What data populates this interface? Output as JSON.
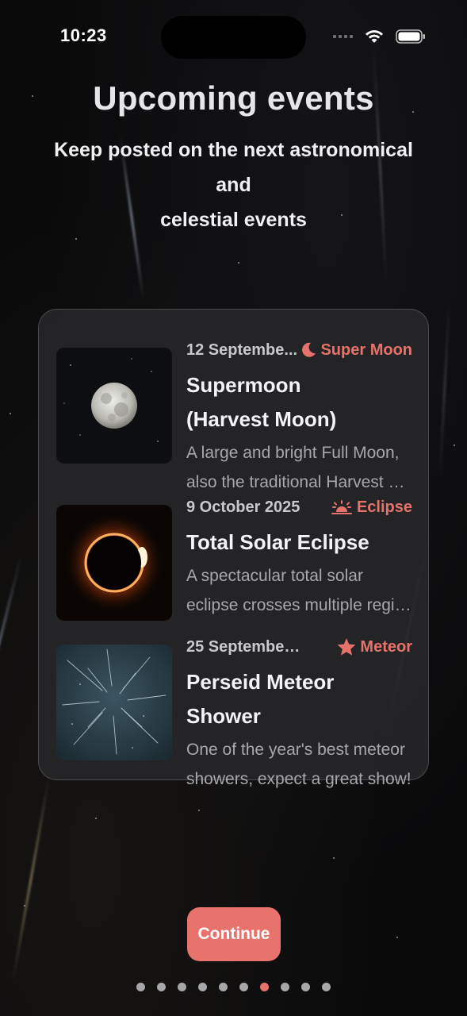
{
  "status": {
    "time": "10:23",
    "icons": [
      "cellular-signal-icon",
      "wifi-icon",
      "battery-icon"
    ]
  },
  "header": {
    "title": "Upcoming events",
    "subtitle_line1": "Keep posted on the next astronomical and",
    "subtitle_line2": "celestial events"
  },
  "events": [
    {
      "date": "12 Septembe...",
      "tag": "Super Moon",
      "tag_icon": "moon-icon",
      "title_line1": "Supermoon",
      "title_line2": "(Harvest Moon)",
      "desc_line1": "A large and bright Full Moon,",
      "desc_line2": "also the traditional Harvest M..."
    },
    {
      "date": "9 October 2025",
      "tag": "Eclipse",
      "tag_icon": "sunset-icon",
      "title_line1": "Total Solar Eclipse",
      "desc_line1": "A spectacular total solar",
      "desc_line2": "eclipse crosses multiple regio..."
    },
    {
      "date": "25 September 20...",
      "tag": "Meteor",
      "tag_icon": "star-icon",
      "title_line1": "Perseid Meteor Shower",
      "desc_line1": "One of the year's best meteor",
      "desc_line2": "showers, expect a great show!"
    }
  ],
  "footer": {
    "continue_label": "Continue",
    "page_count": 10,
    "active_page": 7
  },
  "colors": {
    "accent": "#e8736c",
    "card_bg": "#262629",
    "background": "#0a0a0b"
  }
}
